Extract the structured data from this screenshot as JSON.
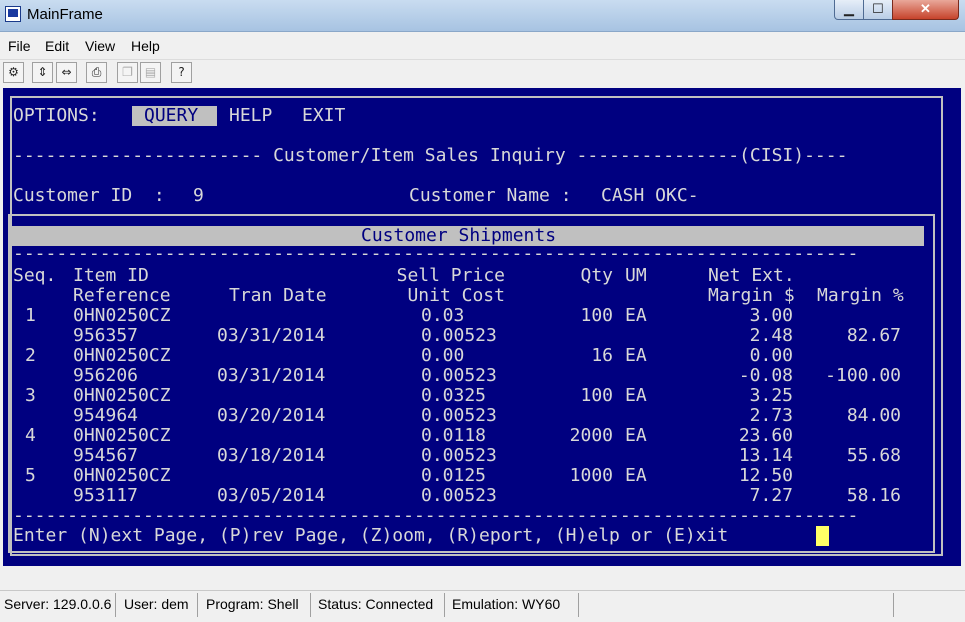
{
  "window": {
    "title": "MainFrame"
  },
  "menu": [
    "File",
    "Edit",
    "View",
    "Help"
  ],
  "toolbar": {
    "icons": [
      "properties-icon",
      "connect-icon",
      "disconnect-icon",
      "print-icon",
      "copy-icon",
      "paste-icon",
      "help-icon"
    ]
  },
  "terminal": {
    "options_label": "OPTIONS:",
    "options": [
      "QUERY",
      "HELP",
      "EXIT"
    ],
    "screen_title": "----------------------- Customer/Item Sales Inquiry ---------------(CISI)----",
    "customer_id_label": "Customer ID  :",
    "customer_id": "9",
    "customer_name_label": "Customer Name :",
    "customer_name": "CASH OKC-",
    "section_title": "Customer Shipments",
    "dash_line": "------------------------------------------------------------------------------",
    "headers_row1": {
      "seq": "Seq.",
      "item": "Item ID",
      "sell_price": "Sell Price",
      "qty": "Qty",
      "um": "UM",
      "net_ext": "Net Ext."
    },
    "headers_row2": {
      "reference": "Reference",
      "tran_date": "Tran Date",
      "unit_cost": "Unit Cost",
      "margin_amt": "Margin $",
      "margin_pct": "Margin %"
    },
    "rows": [
      {
        "seq": "1",
        "item": "0HN0250CZ",
        "sell": "0.03",
        "qty": "100",
        "um": "EA",
        "net": "3.00",
        "ref": "956357",
        "date": "03/31/2014",
        "cost": "0.00523",
        "margin": "2.48",
        "pct": "82.67"
      },
      {
        "seq": "2",
        "item": "0HN0250CZ",
        "sell": "0.00",
        "qty": "16",
        "um": "EA",
        "net": "0.00",
        "ref": "956206",
        "date": "03/31/2014",
        "cost": "0.00523",
        "margin": "-0.08",
        "pct": "-100.00"
      },
      {
        "seq": "3",
        "item": "0HN0250CZ",
        "sell": "0.0325",
        "qty": "100",
        "um": "EA",
        "net": "3.25",
        "ref": "954964",
        "date": "03/20/2014",
        "cost": "0.00523",
        "margin": "2.73",
        "pct": "84.00"
      },
      {
        "seq": "4",
        "item": "0HN0250CZ",
        "sell": "0.0118",
        "qty": "2000",
        "um": "EA",
        "net": "23.60",
        "ref": "954567",
        "date": "03/18/2014",
        "cost": "0.00523",
        "margin": "13.14",
        "pct": "55.68"
      },
      {
        "seq": "5",
        "item": "0HN0250CZ",
        "sell": "0.0125",
        "qty": "1000",
        "um": "EA",
        "net": "12.50",
        "ref": "953117",
        "date": "03/05/2014",
        "cost": "0.00523",
        "margin": "7.27",
        "pct": "58.16"
      }
    ],
    "prompt": "Enter (N)ext Page, (P)rev Page, (Z)oom, (R)eport, (H)elp or (E)xit"
  },
  "status": {
    "server": "Server: 129.0.0.6",
    "user": "User: dem",
    "program": "Program: Shell",
    "state": "Status: Connected",
    "emulation": "Emulation: WY60"
  }
}
